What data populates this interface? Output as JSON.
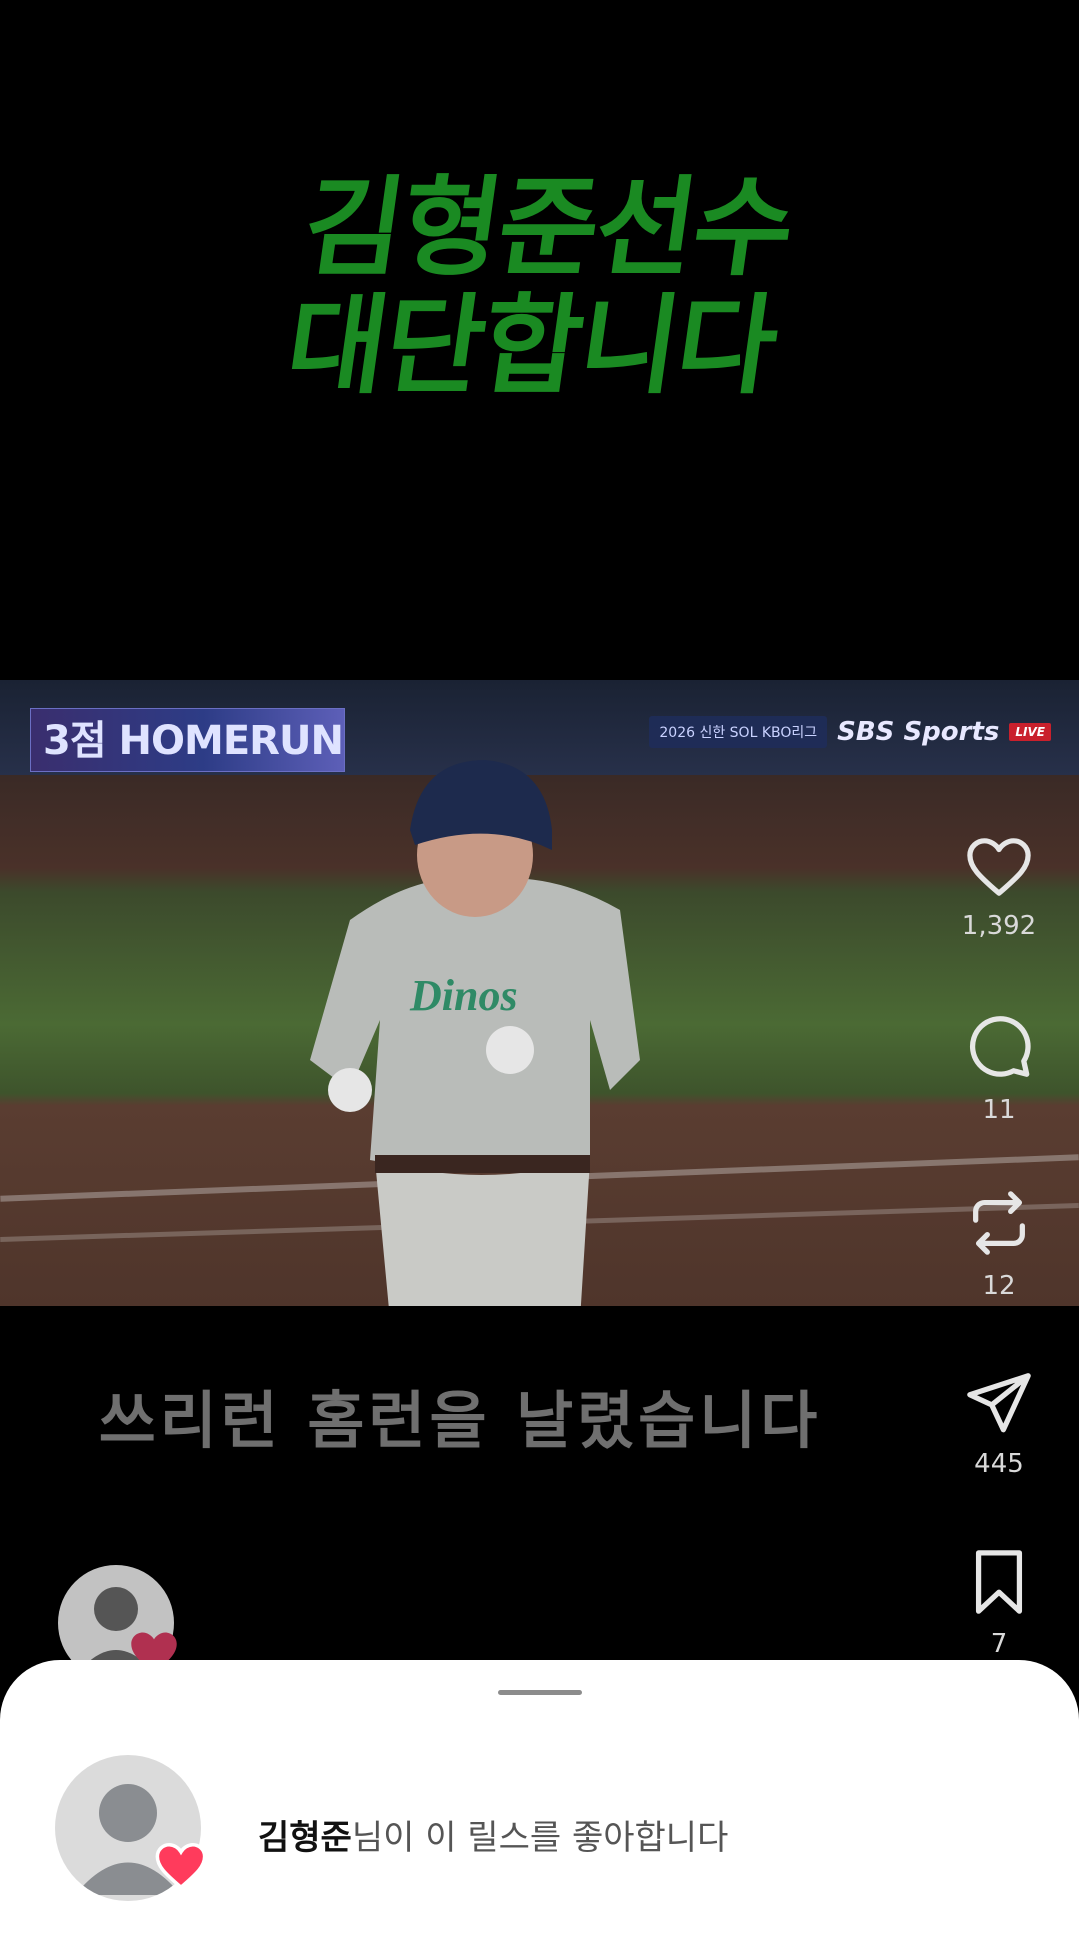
{
  "overlay": {
    "title_line1": "김형준선수",
    "title_line2": "대단합니다"
  },
  "video": {
    "badge_text": "3점 HOMERUN",
    "league_label": "2026 신한 SOL KBO리그",
    "network_label": "SBS Sports",
    "live_label": "LIVE",
    "caption": "쓰리런 홈런을 날렸습니다"
  },
  "actions": {
    "like": {
      "icon": "heart-icon",
      "count": "1,392"
    },
    "comment": {
      "icon": "comment-icon",
      "count": "11"
    },
    "repost": {
      "icon": "repost-icon",
      "count": "12"
    },
    "share": {
      "icon": "send-icon",
      "count": "445"
    },
    "save": {
      "icon": "bookmark-icon",
      "count": "7"
    }
  },
  "sheet": {
    "liker_name": "김형준",
    "message_suffix": "님이 이 릴스를 좋아합니다"
  },
  "colors": {
    "title_green": "#1a8a22",
    "heart_red": "#ff3b5c"
  }
}
